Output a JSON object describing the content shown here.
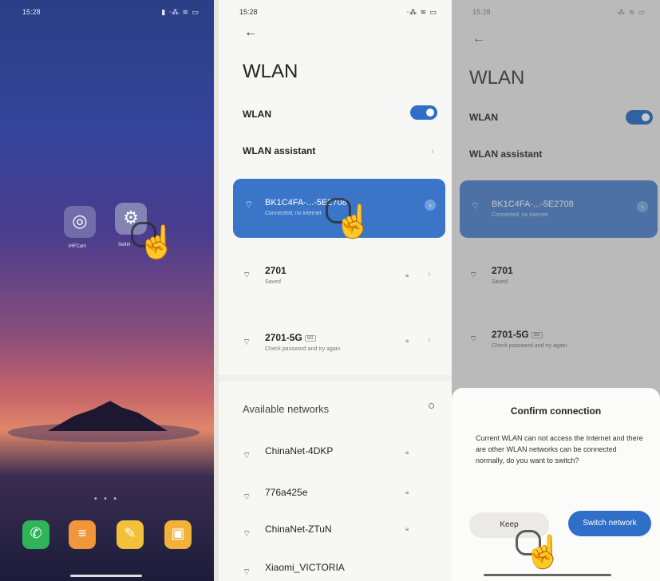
{
  "panel1": {
    "status_time": "15:28",
    "status_icons": "▮ ᐧ⁂ ≋ ▭",
    "apps": [
      {
        "label": "iHFCam",
        "icon": "camera-lens-icon"
      },
      {
        "label": "Settin",
        "icon": "settings-icon"
      }
    ],
    "dock_icons": [
      "phone-icon",
      "menu-icon",
      "notes-icon",
      "gallery-icon"
    ]
  },
  "panel2": {
    "status_time": "15:28",
    "status_icons": "ᐧ⁂ ≋ ▭",
    "title": "WLAN",
    "wlan_label": "WLAN",
    "assistant_label": "WLAN assistant",
    "connected": {
      "ssid": "BK1C4FA-...-5E2708",
      "status": "Connected, no internet"
    },
    "saved_networks": [
      {
        "name": "2701",
        "sub": "Saved",
        "tag": ""
      },
      {
        "name": "2701-5G",
        "sub": "Check password and try again",
        "tag": "5G"
      }
    ],
    "available_label": "Available networks",
    "available_networks": [
      {
        "name": "ChinaNet-4DKP"
      },
      {
        "name": "776a425e"
      },
      {
        "name": "ChinaNet-ZTuN"
      },
      {
        "name": "Xiaomi_VICTORIA"
      }
    ]
  },
  "panel3": {
    "status_time": "15:28",
    "status_icons": "ᐧ⁂ ≋ ▭",
    "title": "WLAN",
    "wlan_label": "WLAN",
    "assistant_label": "WLAN assistant",
    "connected": {
      "ssid": "BK1C4FA-...-5E2708",
      "status": "Connected, no internet"
    },
    "saved_networks": [
      {
        "name": "2701",
        "sub": "Saved",
        "tag": ""
      },
      {
        "name": "2701-5G",
        "sub": "Check password and try again",
        "tag": "5G"
      }
    ],
    "dialog": {
      "title": "Confirm connection",
      "body": "Current WLAN can not access the Internet and there are other WLAN networks can be connected normally, do you want to switch?",
      "keep_label": "Keep",
      "switch_label": "Switch network"
    }
  },
  "colors": {
    "accent": "#2f6fc7",
    "connected_bg": "#3a75c8"
  }
}
